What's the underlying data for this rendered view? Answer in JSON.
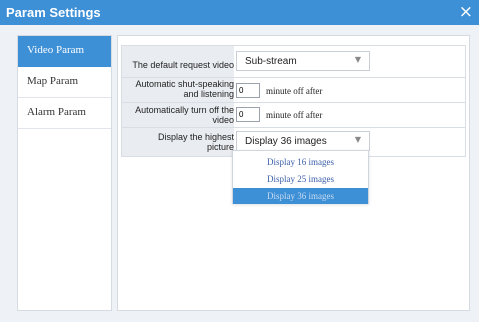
{
  "window": {
    "title": "Param Settings",
    "close_label": "×",
    "accent_color": "#3d8fd6"
  },
  "sidebar": {
    "items": [
      {
        "label": "Video Param",
        "active": true
      },
      {
        "label": "Map Param",
        "active": false
      },
      {
        "label": "Alarm Param",
        "active": false
      }
    ]
  },
  "form": {
    "default_request": {
      "label": "The default request video",
      "value": "Sub-stream",
      "arrow": "▼"
    },
    "auto_shut_speaking": {
      "label_line1": "Automatic shut-speaking",
      "label_line2": "and listening",
      "value": "0",
      "suffix": "minute off after"
    },
    "auto_turn_off_video": {
      "label_line1": "Automatically turn off the",
      "label_line2": "video",
      "value": "0",
      "suffix": "minute off after"
    },
    "display_highest": {
      "label_line1": "Display the highest",
      "label_line2": "picture",
      "value": "Display 36 images",
      "arrow": "▼",
      "options": [
        "Display 16 images",
        "Display 25 images",
        "Display 36 images"
      ],
      "selected_index": 2
    }
  }
}
